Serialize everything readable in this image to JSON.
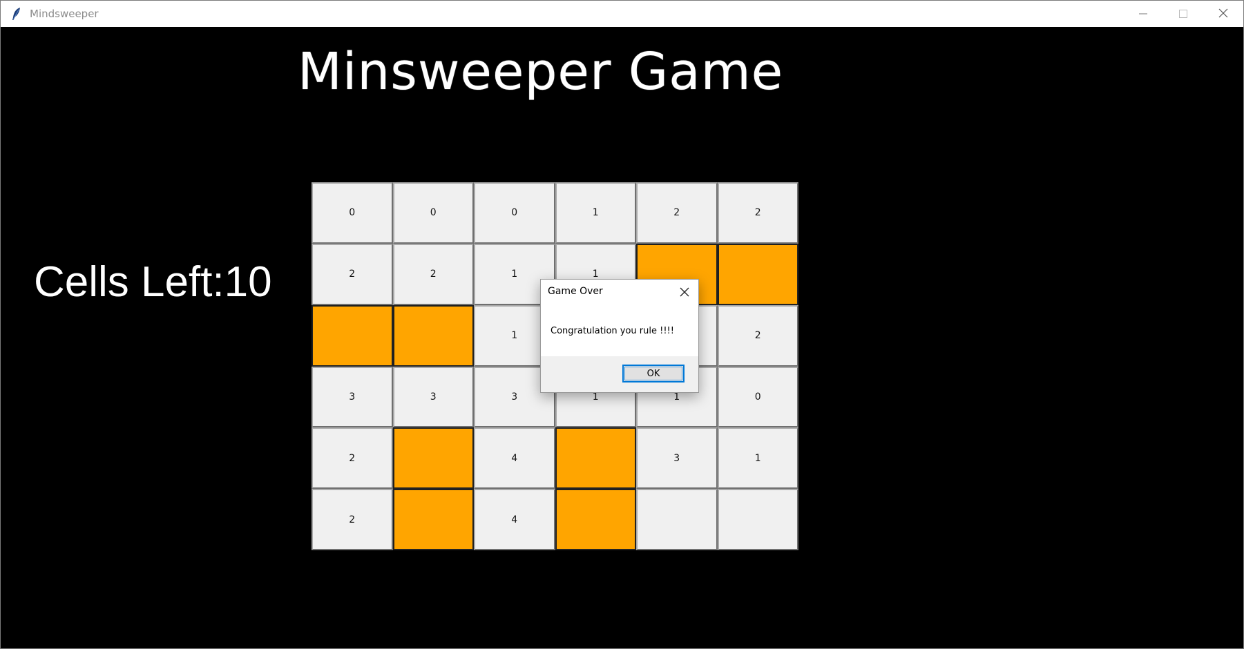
{
  "window": {
    "title": "Mindsweeper",
    "app_icon": "feather-icon",
    "controls": [
      "minimize-icon",
      "maximize-icon",
      "close-icon"
    ]
  },
  "game": {
    "title": "Minsweeper Game",
    "cells_left_label": "Cells Left:10"
  },
  "board": {
    "rows": 6,
    "cols": 6,
    "mine_color": "#ffa500",
    "cell_color": "#f0f0f0",
    "cells": [
      [
        "0",
        "0",
        "0",
        "1",
        "2",
        "2"
      ],
      [
        "2",
        "2",
        "1",
        "1",
        "M",
        "M"
      ],
      [
        "M",
        "M",
        "1",
        "",
        "",
        "2"
      ],
      [
        "3",
        "3",
        "3",
        "1",
        "1",
        "0"
      ],
      [
        "2",
        "M",
        "4",
        "M",
        "3",
        "1"
      ],
      [
        "2",
        "M",
        "4",
        "M",
        "",
        ""
      ]
    ]
  },
  "dialog": {
    "title": "Game Over",
    "message": "Congratulation you rule !!!!",
    "ok_label": "OK",
    "accent": "#0078d7"
  }
}
